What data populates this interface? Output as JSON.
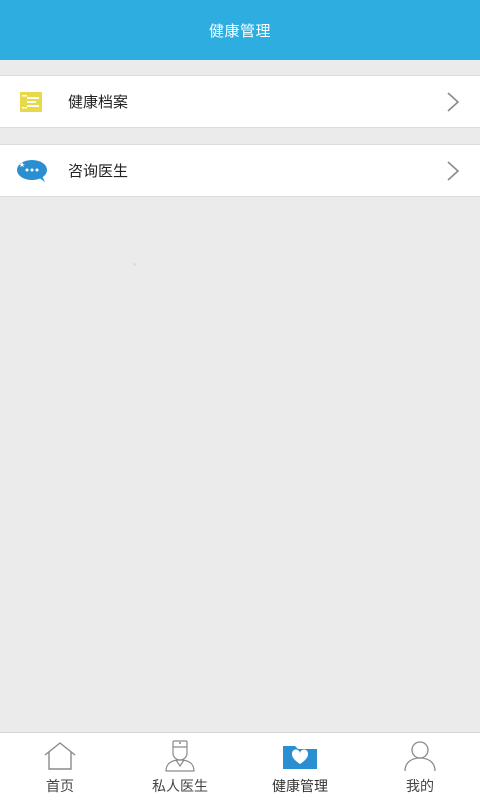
{
  "header": {
    "title": "健康管理"
  },
  "menu": [
    {
      "label": "健康档案",
      "icon": "health-record-icon"
    },
    {
      "label": "咨询医生",
      "icon": "chat-bubble-icon"
    }
  ],
  "tabbar": [
    {
      "label": "首页",
      "icon": "home-icon"
    },
    {
      "label": "私人医生",
      "icon": "doctor-icon"
    },
    {
      "label": "健康管理",
      "icon": "health-folder-icon",
      "active": true
    },
    {
      "label": "我的",
      "icon": "user-icon"
    }
  ],
  "colors": {
    "header": "#2eaee0",
    "accent": "#2a8fd0",
    "record_icon": "#e8d948",
    "background": "#ebebeb"
  }
}
